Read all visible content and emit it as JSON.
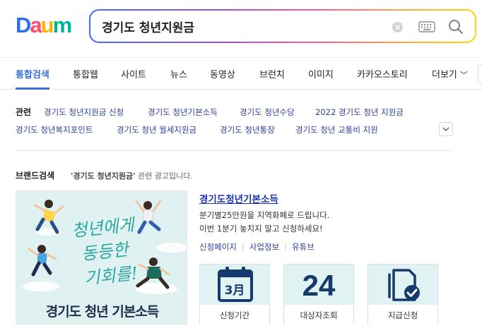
{
  "logo": {
    "text": [
      "D",
      "a",
      "u",
      "m"
    ],
    "colors": [
      "#2d6ff7",
      "#ff4a6b",
      "#ffb400",
      "#00b398"
    ]
  },
  "search": {
    "query": "경기도 청년지원금",
    "placeholder": ""
  },
  "tabs": [
    {
      "label": "통합검색",
      "active": true
    },
    {
      "label": "통합웹"
    },
    {
      "label": "사이트"
    },
    {
      "label": "뉴스"
    },
    {
      "label": "동영상"
    },
    {
      "label": "브런치"
    },
    {
      "label": "이미지"
    },
    {
      "label": "카카오스토리"
    },
    {
      "label": "더보기"
    }
  ],
  "related": {
    "label": "관련",
    "items": [
      "경기도 청년지원금 신청",
      "경기도 청년기본소득",
      "경기도 청년수당",
      "2022 경기도 청년 지원금",
      "경기도 청년복지포인트",
      "경기도 청년 월세지원금",
      "경기도 청년통장",
      "경기도 청년 교통비 지원"
    ]
  },
  "brand": {
    "title": "브랜드검색",
    "note_keyword": "'경기도 청년지원금'",
    "note_suffix": " 관련 광고입니다.",
    "banner_slogan": [
      "청년에게",
      "동등한",
      "기회를!"
    ],
    "banner_text": "경기도 청년 기본소득",
    "ad_title": "경기도청년기본소득",
    "ad_desc": [
      "분기별25만원을 지역화폐로 드립니다.",
      "이번 1분기 놓치지 말고 신청하세요!"
    ],
    "links": [
      "신청페이지",
      "사업정보",
      "유튜브"
    ],
    "cards": [
      {
        "label": "신청기간",
        "icon": "calendar-icon",
        "icon_text": "3月"
      },
      {
        "label": "대상자조회",
        "icon": "number",
        "number": "24"
      },
      {
        "label": "지급신청",
        "icon": "document-check-icon"
      }
    ]
  },
  "colors": {
    "accent": "#3a6fd8",
    "link": "#2c3ea0",
    "ad_title": "#1f35b0",
    "card_bg": "#e0f3f2",
    "card_icon": "#173a6e"
  }
}
